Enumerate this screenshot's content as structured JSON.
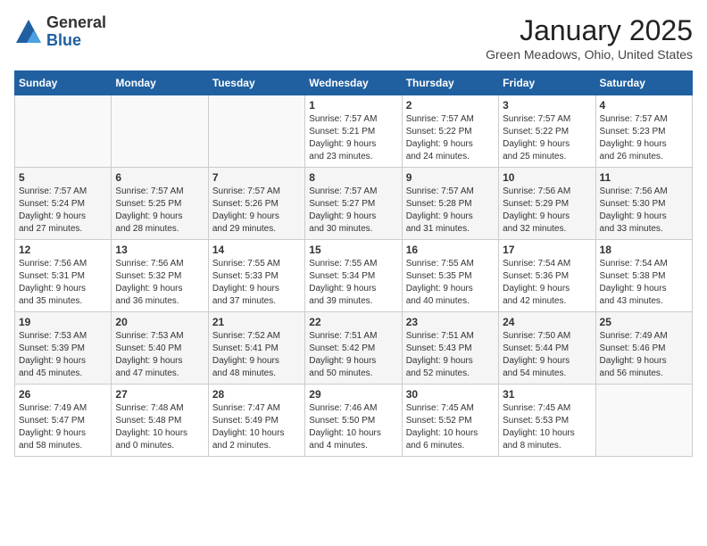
{
  "header": {
    "logo_line1": "General",
    "logo_line2": "Blue",
    "month_title": "January 2025",
    "location": "Green Meadows, Ohio, United States"
  },
  "weekdays": [
    "Sunday",
    "Monday",
    "Tuesday",
    "Wednesday",
    "Thursday",
    "Friday",
    "Saturday"
  ],
  "weeks": [
    [
      {
        "day": "",
        "text": ""
      },
      {
        "day": "",
        "text": ""
      },
      {
        "day": "",
        "text": ""
      },
      {
        "day": "1",
        "text": "Sunrise: 7:57 AM\nSunset: 5:21 PM\nDaylight: 9 hours\nand 23 minutes."
      },
      {
        "day": "2",
        "text": "Sunrise: 7:57 AM\nSunset: 5:22 PM\nDaylight: 9 hours\nand 24 minutes."
      },
      {
        "day": "3",
        "text": "Sunrise: 7:57 AM\nSunset: 5:22 PM\nDaylight: 9 hours\nand 25 minutes."
      },
      {
        "day": "4",
        "text": "Sunrise: 7:57 AM\nSunset: 5:23 PM\nDaylight: 9 hours\nand 26 minutes."
      }
    ],
    [
      {
        "day": "5",
        "text": "Sunrise: 7:57 AM\nSunset: 5:24 PM\nDaylight: 9 hours\nand 27 minutes."
      },
      {
        "day": "6",
        "text": "Sunrise: 7:57 AM\nSunset: 5:25 PM\nDaylight: 9 hours\nand 28 minutes."
      },
      {
        "day": "7",
        "text": "Sunrise: 7:57 AM\nSunset: 5:26 PM\nDaylight: 9 hours\nand 29 minutes."
      },
      {
        "day": "8",
        "text": "Sunrise: 7:57 AM\nSunset: 5:27 PM\nDaylight: 9 hours\nand 30 minutes."
      },
      {
        "day": "9",
        "text": "Sunrise: 7:57 AM\nSunset: 5:28 PM\nDaylight: 9 hours\nand 31 minutes."
      },
      {
        "day": "10",
        "text": "Sunrise: 7:56 AM\nSunset: 5:29 PM\nDaylight: 9 hours\nand 32 minutes."
      },
      {
        "day": "11",
        "text": "Sunrise: 7:56 AM\nSunset: 5:30 PM\nDaylight: 9 hours\nand 33 minutes."
      }
    ],
    [
      {
        "day": "12",
        "text": "Sunrise: 7:56 AM\nSunset: 5:31 PM\nDaylight: 9 hours\nand 35 minutes."
      },
      {
        "day": "13",
        "text": "Sunrise: 7:56 AM\nSunset: 5:32 PM\nDaylight: 9 hours\nand 36 minutes."
      },
      {
        "day": "14",
        "text": "Sunrise: 7:55 AM\nSunset: 5:33 PM\nDaylight: 9 hours\nand 37 minutes."
      },
      {
        "day": "15",
        "text": "Sunrise: 7:55 AM\nSunset: 5:34 PM\nDaylight: 9 hours\nand 39 minutes."
      },
      {
        "day": "16",
        "text": "Sunrise: 7:55 AM\nSunset: 5:35 PM\nDaylight: 9 hours\nand 40 minutes."
      },
      {
        "day": "17",
        "text": "Sunrise: 7:54 AM\nSunset: 5:36 PM\nDaylight: 9 hours\nand 42 minutes."
      },
      {
        "day": "18",
        "text": "Sunrise: 7:54 AM\nSunset: 5:38 PM\nDaylight: 9 hours\nand 43 minutes."
      }
    ],
    [
      {
        "day": "19",
        "text": "Sunrise: 7:53 AM\nSunset: 5:39 PM\nDaylight: 9 hours\nand 45 minutes."
      },
      {
        "day": "20",
        "text": "Sunrise: 7:53 AM\nSunset: 5:40 PM\nDaylight: 9 hours\nand 47 minutes."
      },
      {
        "day": "21",
        "text": "Sunrise: 7:52 AM\nSunset: 5:41 PM\nDaylight: 9 hours\nand 48 minutes."
      },
      {
        "day": "22",
        "text": "Sunrise: 7:51 AM\nSunset: 5:42 PM\nDaylight: 9 hours\nand 50 minutes."
      },
      {
        "day": "23",
        "text": "Sunrise: 7:51 AM\nSunset: 5:43 PM\nDaylight: 9 hours\nand 52 minutes."
      },
      {
        "day": "24",
        "text": "Sunrise: 7:50 AM\nSunset: 5:44 PM\nDaylight: 9 hours\nand 54 minutes."
      },
      {
        "day": "25",
        "text": "Sunrise: 7:49 AM\nSunset: 5:46 PM\nDaylight: 9 hours\nand 56 minutes."
      }
    ],
    [
      {
        "day": "26",
        "text": "Sunrise: 7:49 AM\nSunset: 5:47 PM\nDaylight: 9 hours\nand 58 minutes."
      },
      {
        "day": "27",
        "text": "Sunrise: 7:48 AM\nSunset: 5:48 PM\nDaylight: 10 hours\nand 0 minutes."
      },
      {
        "day": "28",
        "text": "Sunrise: 7:47 AM\nSunset: 5:49 PM\nDaylight: 10 hours\nand 2 minutes."
      },
      {
        "day": "29",
        "text": "Sunrise: 7:46 AM\nSunset: 5:50 PM\nDaylight: 10 hours\nand 4 minutes."
      },
      {
        "day": "30",
        "text": "Sunrise: 7:45 AM\nSunset: 5:52 PM\nDaylight: 10 hours\nand 6 minutes."
      },
      {
        "day": "31",
        "text": "Sunrise: 7:45 AM\nSunset: 5:53 PM\nDaylight: 10 hours\nand 8 minutes."
      },
      {
        "day": "",
        "text": ""
      }
    ]
  ]
}
